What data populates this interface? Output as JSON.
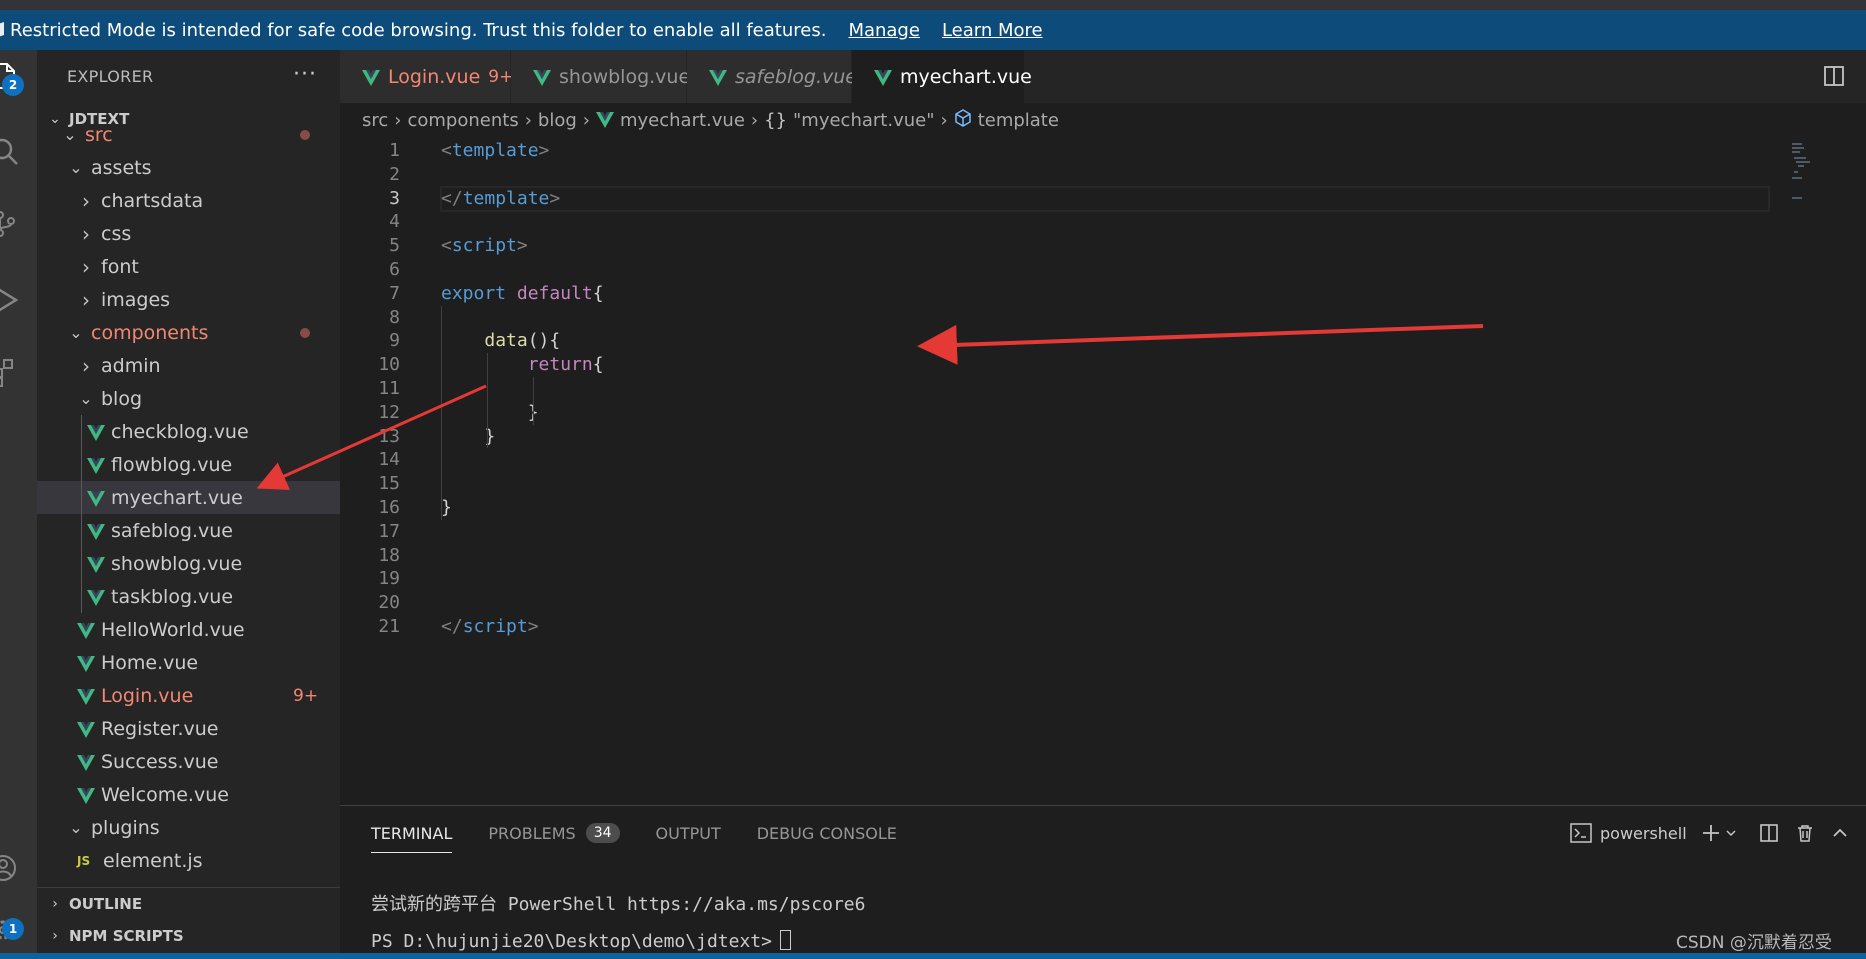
{
  "banner": {
    "message": "Restricted Mode is intended for safe code browsing. Trust this folder to enable all features.",
    "manage_label": "Manage",
    "learn_more_label": "Learn More"
  },
  "activity_bar": {
    "explorer_badge": "2",
    "settings_badge": "1"
  },
  "sidebar": {
    "title": "EXPLORER",
    "more_label": "···",
    "project_name": "JDTEXT",
    "tree": [
      {
        "label": "src",
        "depth": 1,
        "type": "folder-open",
        "status": "modified"
      },
      {
        "label": "assets",
        "depth": 2,
        "type": "folder-open"
      },
      {
        "label": "chartsdata",
        "depth": 3,
        "type": "folder"
      },
      {
        "label": "css",
        "depth": 3,
        "type": "folder"
      },
      {
        "label": "font",
        "depth": 3,
        "type": "folder"
      },
      {
        "label": "images",
        "depth": 3,
        "type": "folder"
      },
      {
        "label": "components",
        "depth": 2,
        "type": "folder-open",
        "status": "modified"
      },
      {
        "label": "admin",
        "depth": 3,
        "type": "folder"
      },
      {
        "label": "blog",
        "depth": 3,
        "type": "folder-open"
      },
      {
        "label": "checkblog.vue",
        "depth": 4,
        "type": "vue"
      },
      {
        "label": "flowblog.vue",
        "depth": 4,
        "type": "vue"
      },
      {
        "label": "myechart.vue",
        "depth": 4,
        "type": "vue",
        "selected": true
      },
      {
        "label": "safeblog.vue",
        "depth": 4,
        "type": "vue"
      },
      {
        "label": "showblog.vue",
        "depth": 4,
        "type": "vue"
      },
      {
        "label": "taskblog.vue",
        "depth": 4,
        "type": "vue"
      },
      {
        "label": "HelloWorld.vue",
        "depth": 3,
        "type": "vue"
      },
      {
        "label": "Home.vue",
        "depth": 3,
        "type": "vue"
      },
      {
        "label": "Login.vue",
        "depth": 3,
        "type": "vue",
        "status": "error",
        "count": "9+"
      },
      {
        "label": "Register.vue",
        "depth": 3,
        "type": "vue"
      },
      {
        "label": "Success.vue",
        "depth": 3,
        "type": "vue"
      },
      {
        "label": "Welcome.vue",
        "depth": 3,
        "type": "vue"
      },
      {
        "label": "plugins",
        "depth": 2,
        "type": "folder-open"
      },
      {
        "label": "element.js",
        "depth": 3,
        "type": "js",
        "icon_text": "JS"
      }
    ],
    "outline_label": "OUTLINE",
    "npm_label": "NPM SCRIPTS"
  },
  "tabs": [
    {
      "label": "Login.vue",
      "count": "9+",
      "status": "error"
    },
    {
      "label": "showblog.vue",
      "dirty": true
    },
    {
      "label": "safeblog.vue",
      "italic": true
    },
    {
      "label": "myechart.vue",
      "active": true,
      "dirty": true
    }
  ],
  "breadcrumb": {
    "parts": [
      "src",
      "components",
      "blog"
    ],
    "file": "myechart.vue",
    "object_symbol": "{}",
    "object": "\"myechart.vue\"",
    "element": "template"
  },
  "editor": {
    "active_line": 3,
    "lines": [
      {
        "n": "1",
        "tokens": [
          [
            "tk-punct",
            "<"
          ],
          [
            "tk-tag",
            "template"
          ],
          [
            "tk-punct",
            ">"
          ]
        ]
      },
      {
        "n": "2",
        "tokens": []
      },
      {
        "n": "3",
        "tokens": [
          [
            "tk-punct",
            "</"
          ],
          [
            "tk-tag",
            "template"
          ],
          [
            "tk-punct",
            ">"
          ]
        ]
      },
      {
        "n": "4",
        "tokens": []
      },
      {
        "n": "5",
        "tokens": [
          [
            "tk-punct",
            "<"
          ],
          [
            "tk-tag",
            "script"
          ],
          [
            "tk-punct",
            ">"
          ]
        ]
      },
      {
        "n": "6",
        "tokens": []
      },
      {
        "n": "7",
        "tokens": [
          [
            "tk-kw",
            "export"
          ],
          [
            "tk-txt",
            " "
          ],
          [
            "tk-kw2",
            "default"
          ],
          [
            "tk-txt",
            "{"
          ]
        ]
      },
      {
        "n": "8",
        "tokens": []
      },
      {
        "n": "9",
        "tokens": [
          [
            "tk-txt",
            "    "
          ],
          [
            "tk-fn",
            "data"
          ],
          [
            "tk-txt",
            "(){"
          ]
        ]
      },
      {
        "n": "10",
        "tokens": [
          [
            "tk-txt",
            "        "
          ],
          [
            "tk-kw2",
            "return"
          ],
          [
            "tk-txt",
            "{"
          ]
        ]
      },
      {
        "n": "11",
        "tokens": []
      },
      {
        "n": "12",
        "tokens": [
          [
            "tk-txt",
            "        }"
          ]
        ]
      },
      {
        "n": "13",
        "tokens": [
          [
            "tk-txt",
            "    }"
          ]
        ]
      },
      {
        "n": "14",
        "tokens": []
      },
      {
        "n": "15",
        "tokens": []
      },
      {
        "n": "16",
        "tokens": [
          [
            "tk-txt",
            "}"
          ]
        ]
      },
      {
        "n": "17",
        "tokens": []
      },
      {
        "n": "18",
        "tokens": []
      },
      {
        "n": "19",
        "tokens": []
      },
      {
        "n": "20",
        "tokens": []
      },
      {
        "n": "21",
        "tokens": [
          [
            "tk-punct",
            "</"
          ],
          [
            "tk-tag",
            "script"
          ],
          [
            "tk-punct",
            ">"
          ]
        ]
      }
    ]
  },
  "panel": {
    "tabs": [
      {
        "label": "TERMINAL",
        "active": true
      },
      {
        "label": "PROBLEMS",
        "badge": "34"
      },
      {
        "label": "OUTPUT"
      },
      {
        "label": "DEBUG CONSOLE"
      }
    ],
    "shell_label": "powershell",
    "terminal_lines": [
      "尝试新的跨平台 PowerShell https://aka.ms/pscore6",
      "PS D:\\hujunjie20\\Desktop\\demo\\jdtext>"
    ]
  },
  "watermark": "CSDN @沉默着忍受",
  "colors": {
    "banner_bg": "#0d4b7a",
    "error_text": "#f48771",
    "vue_green": "#41b883",
    "annotation_arrow": "#e53935"
  }
}
